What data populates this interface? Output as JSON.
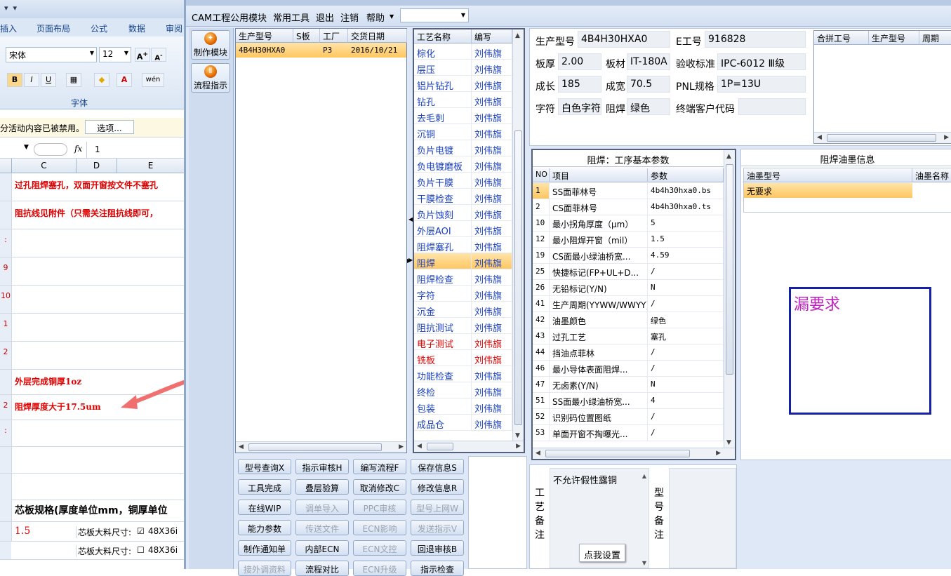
{
  "excel": {
    "tabs": [
      "插入",
      "页面布局",
      "公式",
      "数据",
      "审阅"
    ],
    "font_name": "宋体",
    "font_size": "12",
    "group_label": "字体",
    "security_msg": "分活动内容已被禁用。",
    "options_btn": "选项...",
    "name_box": "",
    "fx_label": "fx",
    "formula_value": "1",
    "col_headers": [
      "C",
      "D",
      "E"
    ],
    "rows": [
      {
        "num": "",
        "text": "过孔阻焊塞孔，双面开窗按文件不塞孔"
      },
      {
        "num": "",
        "text": "阻抗线见附件（只需关注阻抗线即可，"
      },
      {
        "num": ":",
        "text": ""
      },
      {
        "num": "9",
        "text": ""
      },
      {
        "num": "10",
        "text": ""
      },
      {
        "num": "1",
        "text": ""
      },
      {
        "num": "2",
        "text": ""
      },
      {
        "num": "",
        "text": "外层完成铜厚1oz"
      },
      {
        "num": "2",
        "text": "阻焊厚度大于17.5um"
      },
      {
        "num": ":",
        "text": ""
      },
      {
        "num": "",
        "text": ""
      },
      {
        "num": "",
        "text": ""
      }
    ],
    "core_title": "芯板规格(厚度单位mm，铜厚单位",
    "core_rows": [
      {
        "thickness": "1.5",
        "label": "芯板大料尺寸:",
        "checked": true,
        "value": "48X36i"
      },
      {
        "thickness": "",
        "label": "芯板大料尺寸:",
        "checked": false,
        "value": "48X36i"
      }
    ]
  },
  "app": {
    "menu": [
      "CAM工程",
      "公用模块",
      "常用工具",
      "退出",
      "注销",
      "帮助"
    ],
    "left_buttons": [
      "制作模块",
      "流程指示"
    ],
    "order_grid": {
      "headers": [
        "生产型号",
        "S板",
        "工厂",
        "交货日期"
      ],
      "rows": [
        {
          "model": "4B4H30HXA0",
          "s": "",
          "factory": "P3",
          "date": "2016/10/21"
        }
      ]
    },
    "process_grid": {
      "headers": [
        "工艺名称",
        "编写"
      ],
      "rows": [
        {
          "name": "棕化",
          "author": "刘伟旗",
          "red": false
        },
        {
          "name": "层压",
          "author": "刘伟旗",
          "red": false
        },
        {
          "name": "铝片钻孔",
          "author": "刘伟旗",
          "red": false
        },
        {
          "name": "钻孔",
          "author": "刘伟旗",
          "red": false
        },
        {
          "name": "去毛刺",
          "author": "刘伟旗",
          "red": false
        },
        {
          "name": "沉铜",
          "author": "刘伟旗",
          "red": false
        },
        {
          "name": "负片电镀",
          "author": "刘伟旗",
          "red": false
        },
        {
          "name": "负电镀磨板",
          "author": "刘伟旗",
          "red": false
        },
        {
          "name": "负片干膜",
          "author": "刘伟旗",
          "red": false
        },
        {
          "name": "干膜检查",
          "author": "刘伟旗",
          "red": false
        },
        {
          "name": "负片蚀刻",
          "author": "刘伟旗",
          "red": false
        },
        {
          "name": "外层AOI",
          "author": "刘伟旗",
          "red": false
        },
        {
          "name": "阻焊塞孔",
          "author": "刘伟旗",
          "red": false
        },
        {
          "name": "阻焊",
          "author": "刘伟旗",
          "red": false,
          "selected": true
        },
        {
          "name": "阻焊检查",
          "author": "刘伟旗",
          "red": false
        },
        {
          "name": "字符",
          "author": "刘伟旗",
          "red": false
        },
        {
          "name": "沉金",
          "author": "刘伟旗",
          "red": false
        },
        {
          "name": "阻抗测试",
          "author": "刘伟旗",
          "red": false
        },
        {
          "name": "电子测试",
          "author": "刘伟旗",
          "red": true
        },
        {
          "name": "铣板",
          "author": "刘伟旗",
          "red": true
        },
        {
          "name": "功能检查",
          "author": "刘伟旗",
          "red": false
        },
        {
          "name": "终检",
          "author": "刘伟旗",
          "red": false
        },
        {
          "name": "包装",
          "author": "刘伟旗",
          "red": false
        },
        {
          "name": "成品仓",
          "author": "刘伟旗",
          "red": false
        }
      ]
    },
    "info": {
      "model_label": "生产型号",
      "model": "4B4H30HXA0",
      "eno_label": "E工号",
      "eno": "916828",
      "thick_label": "板厚",
      "thick": "2.00",
      "mat_label": "板材",
      "mat": "IT-180A",
      "std_label": "验收标准",
      "std": "IPC-6012 Ⅲ级",
      "len_label": "成长",
      "len": "185",
      "wid_label": "成宽",
      "wid": "70.5",
      "pnl_label": "PNL规格",
      "pnl": "1P=13U",
      "char_label": "字符",
      "char": "白色字符",
      "mask_label": "阻焊",
      "mask": "绿色",
      "cust_label": "终端客户代码",
      "cust": ""
    },
    "combine_grid": {
      "headers": [
        "合拼工号",
        "生产型号",
        "周期"
      ]
    },
    "param_panel": {
      "title": "阻焊：工序基本参数",
      "headers": [
        "NO",
        "项目",
        "参数"
      ],
      "rows": [
        {
          "no": "1",
          "item": "SS面菲林号",
          "val": "4b4h30hxa0.bs",
          "selected": true
        },
        {
          "no": "2",
          "item": "CS面菲林号",
          "val": "4b4h30hxa0.ts"
        },
        {
          "no": "10",
          "item": "最小拐角厚度（μm）",
          "val": "5"
        },
        {
          "no": "12",
          "item": "最小阻焊开窗（mil）",
          "val": "1.5"
        },
        {
          "no": "19",
          "item": "CS面最小绿油桥宽...",
          "val": "4.59"
        },
        {
          "no": "25",
          "item": "快捷标记(FP+UL+D...",
          "val": "/"
        },
        {
          "no": "26",
          "item": "无铅标记(Y/N)",
          "val": "N"
        },
        {
          "no": "41",
          "item": "生产周期(YYWW/WWYY)",
          "val": "/"
        },
        {
          "no": "42",
          "item": "油墨颜色",
          "val": "绿色"
        },
        {
          "no": "43",
          "item": "过孔工艺",
          "val": "塞孔"
        },
        {
          "no": "44",
          "item": "挡油点菲林",
          "val": "/"
        },
        {
          "no": "46",
          "item": "最小导体表面阻焊...",
          "val": "/"
        },
        {
          "no": "47",
          "item": "无卤素(Y/N)",
          "val": "N"
        },
        {
          "no": "51",
          "item": "SS面最小绿油桥宽...",
          "val": "4"
        },
        {
          "no": "52",
          "item": "识别码位置图纸",
          "val": "/"
        },
        {
          "no": "53",
          "item": "单面开窗不掏曝光...",
          "val": "/"
        }
      ]
    },
    "ink_panel": {
      "title": "阻焊油墨信息",
      "headers": [
        "油墨型号",
        "油墨名称"
      ],
      "rows": [
        {
          "type": "无要求",
          "name": ""
        }
      ],
      "note": "漏要求"
    },
    "buttons": [
      [
        "型号查询X",
        "指示审核H",
        "编写流程F",
        "保存信息S"
      ],
      [
        "工具完成",
        "叠层验算",
        "取消修改C",
        "修改信息R"
      ],
      [
        "在线WIP",
        "调单导入",
        "PPC审核",
        "型号上网W"
      ],
      [
        "能力参数",
        "传送文件",
        "ECN影响",
        "发送指示V"
      ],
      [
        "制作通知单",
        "内部ECN",
        "ECN文控",
        "回退审核B"
      ],
      [
        "接外调资料",
        "流程对比",
        "ECN升级",
        "指示检查"
      ]
    ],
    "disabled_buttons": [
      "调单导入",
      "PPC审核",
      "型号上网W",
      "传送文件",
      "ECN影响",
      "发送指示V",
      "ECN文控",
      "接外调资料",
      "ECN升级"
    ],
    "remarks": {
      "process_label": "工艺备注",
      "process_text": "不允许假性露铜",
      "setting_btn": "点我设置",
      "model_label": "型号备注"
    }
  }
}
